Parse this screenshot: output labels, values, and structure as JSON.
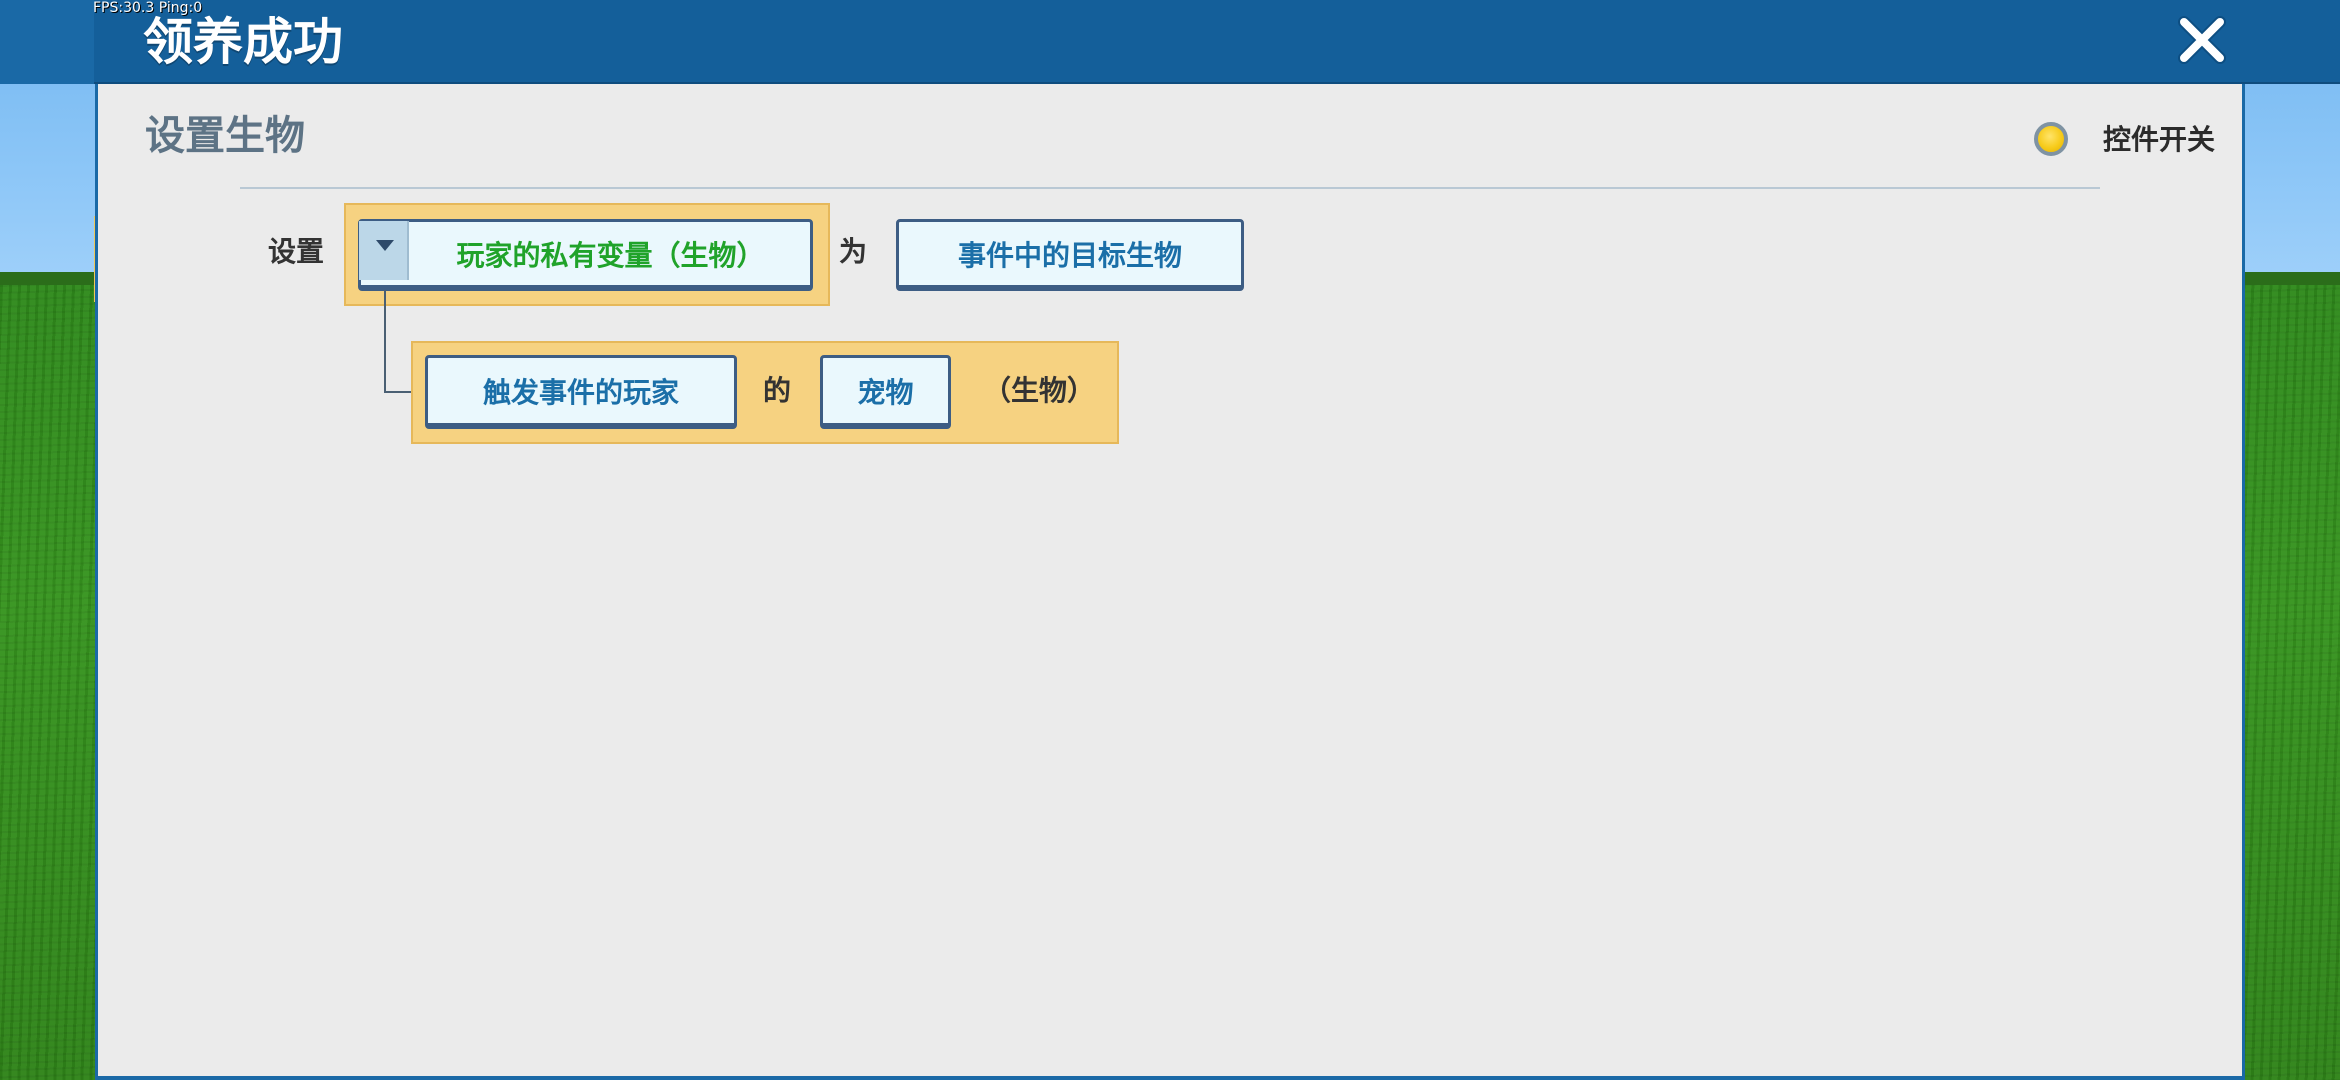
{
  "overlay": {
    "fps_text": "FPS:30.3  Ping:0"
  },
  "header": {
    "title": "领养成功",
    "close_icon": "close-icon"
  },
  "panel": {
    "section_title": "设置生物",
    "toggle": {
      "label": "控件开关",
      "state_color": "#f7cb1a"
    }
  },
  "rule": {
    "row1": {
      "prefix": "设置",
      "variable_dropdown": "玩家的私有变量（生物）",
      "connector_word": "为",
      "value_button": "事件中的目标生物"
    },
    "row2": {
      "player_button": "触发事件的玩家",
      "of_word": "的",
      "pet_button": "宠物",
      "type_hint": "（生物）"
    }
  },
  "colors": {
    "header_bg": "#145f9a",
    "panel_bg": "#ebebeb",
    "slot_bg": "#f6d281",
    "button_text_blue": "#1b6fa8",
    "button_text_green": "#20a32a"
  }
}
